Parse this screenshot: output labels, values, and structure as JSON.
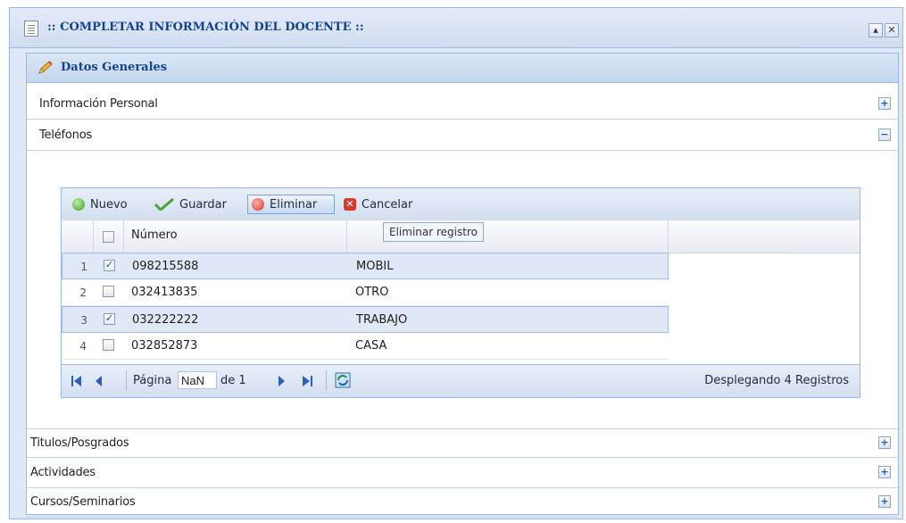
{
  "window": {
    "title": ":: COMPLETAR INFORMACIÓN DEL DOCENTE ::",
    "controls": [
      "collapse",
      "close"
    ]
  },
  "panel": {
    "title": "Datos Generales"
  },
  "accordion": [
    {
      "label": "Información Personal",
      "state": "collapsed"
    },
    {
      "label": "Teléfonos",
      "state": "expanded"
    },
    {
      "label": "Titulos/Posgrados",
      "state": "collapsed"
    },
    {
      "label": "Actividades",
      "state": "collapsed"
    },
    {
      "label": "Cursos/Seminarios",
      "state": "collapsed"
    }
  ],
  "toolbar": {
    "nuevo": "Nuevo",
    "guardar": "Guardar",
    "eliminar": "Eliminar",
    "cancelar": "Cancelar"
  },
  "tooltip": "Eliminar registro",
  "grid": {
    "columns": [
      "Número",
      ""
    ],
    "rows": [
      {
        "index": "1",
        "checked": true,
        "numero": "098215588",
        "tipo": "MOBIL"
      },
      {
        "index": "2",
        "checked": false,
        "numero": "032413835",
        "tipo": "OTRO"
      },
      {
        "index": "3",
        "checked": true,
        "numero": "032222222",
        "tipo": "TRABAJO"
      },
      {
        "index": "4",
        "checked": false,
        "numero": "032852873",
        "tipo": "CASA"
      }
    ]
  },
  "pager": {
    "page_label": "Página",
    "page_value": "NaN",
    "of_label": "de 1",
    "status": "Desplegando 4 Registros"
  },
  "colors": {
    "accent": "#15428b",
    "border": "#99bbe8",
    "selected_row": "#dfe8f6"
  }
}
